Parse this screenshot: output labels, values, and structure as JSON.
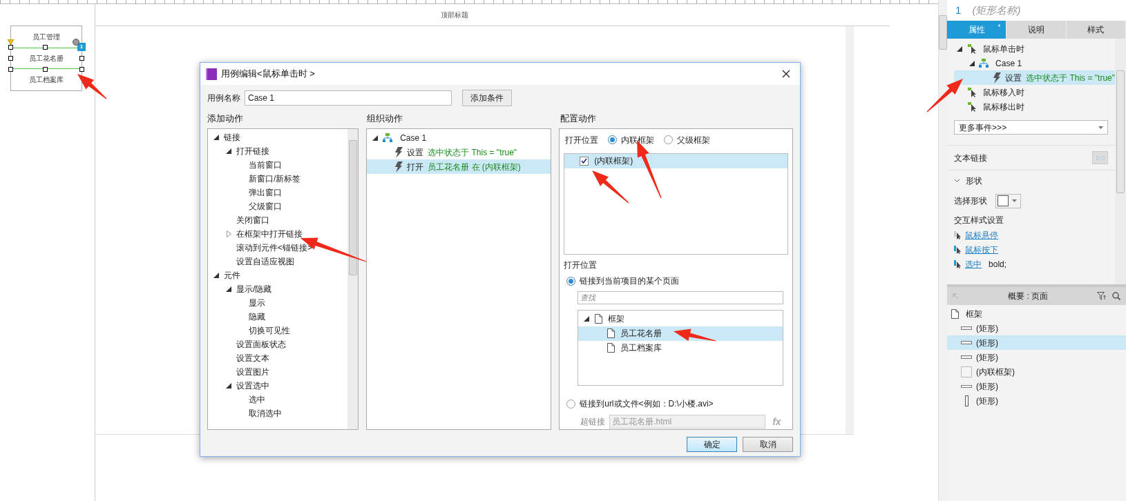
{
  "canvas": {
    "menu_items": [
      {
        "label": "员工管理",
        "selected": false
      },
      {
        "label": "员工花名册",
        "selected": true
      },
      {
        "label": "员工档案库",
        "selected": false
      }
    ],
    "badge": "1",
    "header_title": "顶部标题"
  },
  "dialog": {
    "title": "用例编辑<鼠标单击时 >",
    "case_name_label": "用例名称",
    "case_name": "Case 1",
    "add_condition": "添加条件",
    "add_actions": {
      "title": "添加动作",
      "tree": [
        {
          "label": "链接",
          "expanded": true,
          "children": [
            {
              "label": "打开链接",
              "expanded": true,
              "children": [
                {
                  "label": "当前窗口"
                },
                {
                  "label": "新窗口/新标签"
                },
                {
                  "label": "弹出窗口"
                },
                {
                  "label": "父级窗口"
                }
              ]
            },
            {
              "label": "关闭窗口"
            },
            {
              "label": "在框架中打开链接",
              "expanded": false
            },
            {
              "label": "滚动到元件<锚链接>"
            },
            {
              "label": "设置自适应视图"
            }
          ]
        },
        {
          "label": "元件",
          "expanded": true,
          "children": [
            {
              "label": "显示/隐藏",
              "expanded": true,
              "children": [
                {
                  "label": "显示"
                },
                {
                  "label": "隐藏"
                },
                {
                  "label": "切换可见性"
                }
              ]
            },
            {
              "label": "设置面板状态"
            },
            {
              "label": "设置文本"
            },
            {
              "label": "设置图片"
            },
            {
              "label": "设置选中",
              "expanded": true,
              "children": [
                {
                  "label": "选中"
                },
                {
                  "label": "取消选中"
                }
              ]
            }
          ]
        }
      ]
    },
    "organize": {
      "title": "组织动作",
      "case": {
        "label": "Case 1",
        "expanded": true
      },
      "actions": [
        {
          "verb": "设置",
          "detail": "选中状态于 This = \"true\"",
          "selected": false
        },
        {
          "verb": "打开",
          "detail": "员工花名册 在 (内联框架)",
          "selected": true
        }
      ]
    },
    "config": {
      "title": "配置动作",
      "target_label": "打开位置",
      "targets": [
        {
          "label": "内联框架",
          "selected": true
        },
        {
          "label": "父级框架",
          "selected": false
        }
      ],
      "frames": [
        {
          "label": "(内联框架)",
          "checked": true,
          "selected": true
        }
      ],
      "location_label": "打开位置",
      "page_option": {
        "label": "链接到当前项目的某个页面",
        "selected": true
      },
      "search": {
        "placeholder": "查找"
      },
      "pages": [
        {
          "label": "框架",
          "expanded": true,
          "selected": false,
          "children": [
            {
              "label": "员工花名册",
              "selected": true
            },
            {
              "label": "员工档案库",
              "selected": false
            }
          ]
        }
      ],
      "url_option": {
        "label": "链接到url或文件<例如：D:\\小楼.avi>",
        "selected": false
      },
      "hyperlink_label": "超链接",
      "hyperlink": "员工花名册.html",
      "fx": "fx"
    },
    "buttons": [
      {
        "label": "确定",
        "kind": "primary"
      },
      {
        "label": "取消",
        "kind": "default"
      }
    ]
  },
  "right_panel": {
    "widget_number": "1",
    "widget_name": "(矩形名称)",
    "tabs": [
      {
        "label": "属性",
        "selected": true,
        "mark": "*"
      },
      {
        "label": "说明",
        "selected": false
      },
      {
        "label": "样式",
        "selected": false
      }
    ],
    "events": [
      {
        "label": "鼠标单击时",
        "expanded": true,
        "cases": [
          {
            "label": "Case 1",
            "expanded": true,
            "actions": [
              {
                "verb": "设置",
                "detail": "选中状态于 This = \"true\"",
                "selected": true
              }
            ]
          }
        ]
      },
      {
        "label": "鼠标移入时"
      },
      {
        "label": "鼠标移出时"
      }
    ],
    "more_events": "更多事件>>>",
    "text_link_label": "文本链接",
    "shape_section": {
      "label": "形状",
      "expanded": true
    },
    "select_shape_label": "选择形状",
    "interaction_label": "交互样式设置",
    "interaction_styles": [
      {
        "label": "鼠标悬停"
      },
      {
        "label": "鼠标按下"
      },
      {
        "label": "选中",
        "value": "bold;"
      }
    ],
    "outline": {
      "title": "概要 : 页面",
      "page": "框架",
      "items": [
        {
          "label": "(矩形)",
          "kind": "bar",
          "selected": false
        },
        {
          "label": "(矩形)",
          "kind": "bar",
          "selected": true
        },
        {
          "label": "(矩形)",
          "kind": "bar",
          "selected": false
        },
        {
          "label": "(内联框架)",
          "kind": "frame",
          "selected": false
        },
        {
          "label": "(矩形)",
          "kind": "line",
          "selected": false
        },
        {
          "label": "(矩形)",
          "kind": "vbar",
          "selected": false
        }
      ]
    }
  }
}
